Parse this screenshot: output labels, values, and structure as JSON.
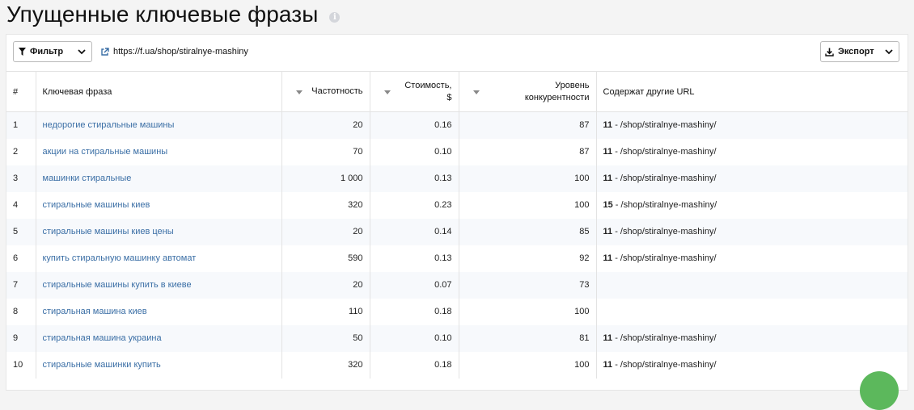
{
  "page": {
    "title": "Упущенные ключевые фразы"
  },
  "toolbar": {
    "filter_label": "Фильтр",
    "url": "https://f.ua/shop/stiralnye-mashiny",
    "export_label": "Экспорт"
  },
  "table": {
    "headers": {
      "num": "#",
      "keyword": "Ключевая фраза",
      "frequency": "Частотность",
      "cost_line1": "Стоимость,",
      "cost_line2": "$",
      "competition_line1": "Уровень",
      "competition_line2": "конкурентности",
      "other_urls": "Содержат другие URL"
    },
    "rows": [
      {
        "n": "1",
        "keyword": "недорогие стиральные машины",
        "freq": "20",
        "cost": "0.16",
        "comp": "87",
        "url_count": "11",
        "url_path": " - /shop/stiralnye-mashiny/"
      },
      {
        "n": "2",
        "keyword": "акции на стиральные машины",
        "freq": "70",
        "cost": "0.10",
        "comp": "87",
        "url_count": "11",
        "url_path": " - /shop/stiralnye-mashiny/"
      },
      {
        "n": "3",
        "keyword": "машинки стиральные",
        "freq": "1 000",
        "cost": "0.13",
        "comp": "100",
        "url_count": "11",
        "url_path": " - /shop/stiralnye-mashiny/"
      },
      {
        "n": "4",
        "keyword": "стиральные машины киев",
        "freq": "320",
        "cost": "0.23",
        "comp": "100",
        "url_count": "15",
        "url_path": " - /shop/stiralnye-mashiny/"
      },
      {
        "n": "5",
        "keyword": "стиральные машины киев цены",
        "freq": "20",
        "cost": "0.14",
        "comp": "85",
        "url_count": "11",
        "url_path": " - /shop/stiralnye-mashiny/"
      },
      {
        "n": "6",
        "keyword": "купить стиральную машинку автомат",
        "freq": "590",
        "cost": "0.13",
        "comp": "92",
        "url_count": "11",
        "url_path": " - /shop/stiralnye-mashiny/"
      },
      {
        "n": "7",
        "keyword": "стиральные машины купить в киеве",
        "freq": "20",
        "cost": "0.07",
        "comp": "73",
        "url_count": "",
        "url_path": ""
      },
      {
        "n": "8",
        "keyword": "стиральная машина киев",
        "freq": "110",
        "cost": "0.18",
        "comp": "100",
        "url_count": "",
        "url_path": ""
      },
      {
        "n": "9",
        "keyword": "стиральная машина украина",
        "freq": "50",
        "cost": "0.10",
        "comp": "81",
        "url_count": "11",
        "url_path": " - /shop/stiralnye-mashiny/"
      },
      {
        "n": "10",
        "keyword": "стиральные машинки купить",
        "freq": "320",
        "cost": "0.18",
        "comp": "100",
        "url_count": "11",
        "url_path": " - /shop/stiralnye-mashiny/"
      }
    ]
  },
  "colors": {
    "link": "#3a6ea5",
    "row_stripe": "#f7f9fc",
    "fab": "#5cb85c"
  },
  "icons": [
    "info-icon",
    "filter-icon",
    "chevron-down-icon",
    "external-link-icon",
    "download-icon",
    "sort-icon"
  ]
}
